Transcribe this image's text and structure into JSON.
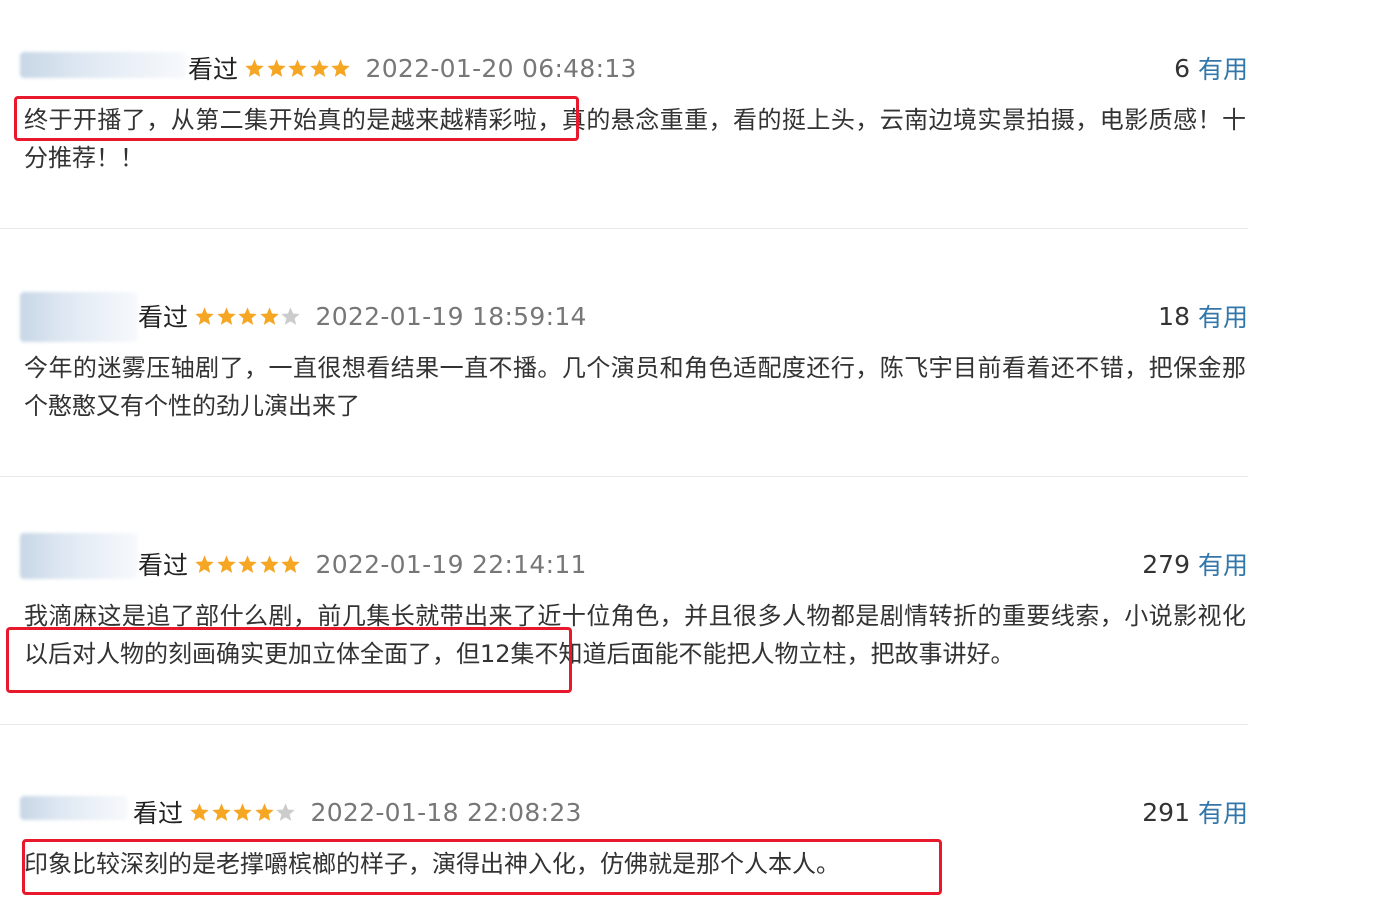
{
  "labels": {
    "watched": "看过",
    "useful": "有用"
  },
  "colors": {
    "star_filled": "#f5a623",
    "star_empty": "#cccccc",
    "highlight": "#e8192c",
    "link": "#3377aa"
  },
  "reviews": [
    {
      "rating": 5,
      "time": "2022-01-20 06:48:13",
      "votes": "6",
      "content": "终于开播了，从第二集开始真的是越来越精彩啦，真的悬念重重，看的挺上头，云南边境实景拍摄，电影质感！十分推荐！！"
    },
    {
      "rating": 4,
      "time": "2022-01-19 18:59:14",
      "votes": "18",
      "content": "今年的迷雾压轴剧了，一直很想看结果一直不播。几个演员和角色适配度还行，陈飞宇目前看着还不错，把保金那个憨憨又有个性的劲儿演出来了"
    },
    {
      "rating": 5,
      "time": "2022-01-19 22:14:11",
      "votes": "279",
      "content": "我滴麻这是追了部什么剧，前几集长就带出来了近十位角色，并且很多人物都是剧情转折的重要线索，小说影视化以后对人物的刻画确实更加立体全面了，但12集不知道后面能不能把人物立柱，把故事讲好。"
    },
    {
      "rating": 4,
      "time": "2022-01-18 22:08:23",
      "votes": "291",
      "content": "印象比较深刻的是老撑嚼槟榔的样子，演得出神入化，仿佛就是那个人本人。"
    }
  ]
}
